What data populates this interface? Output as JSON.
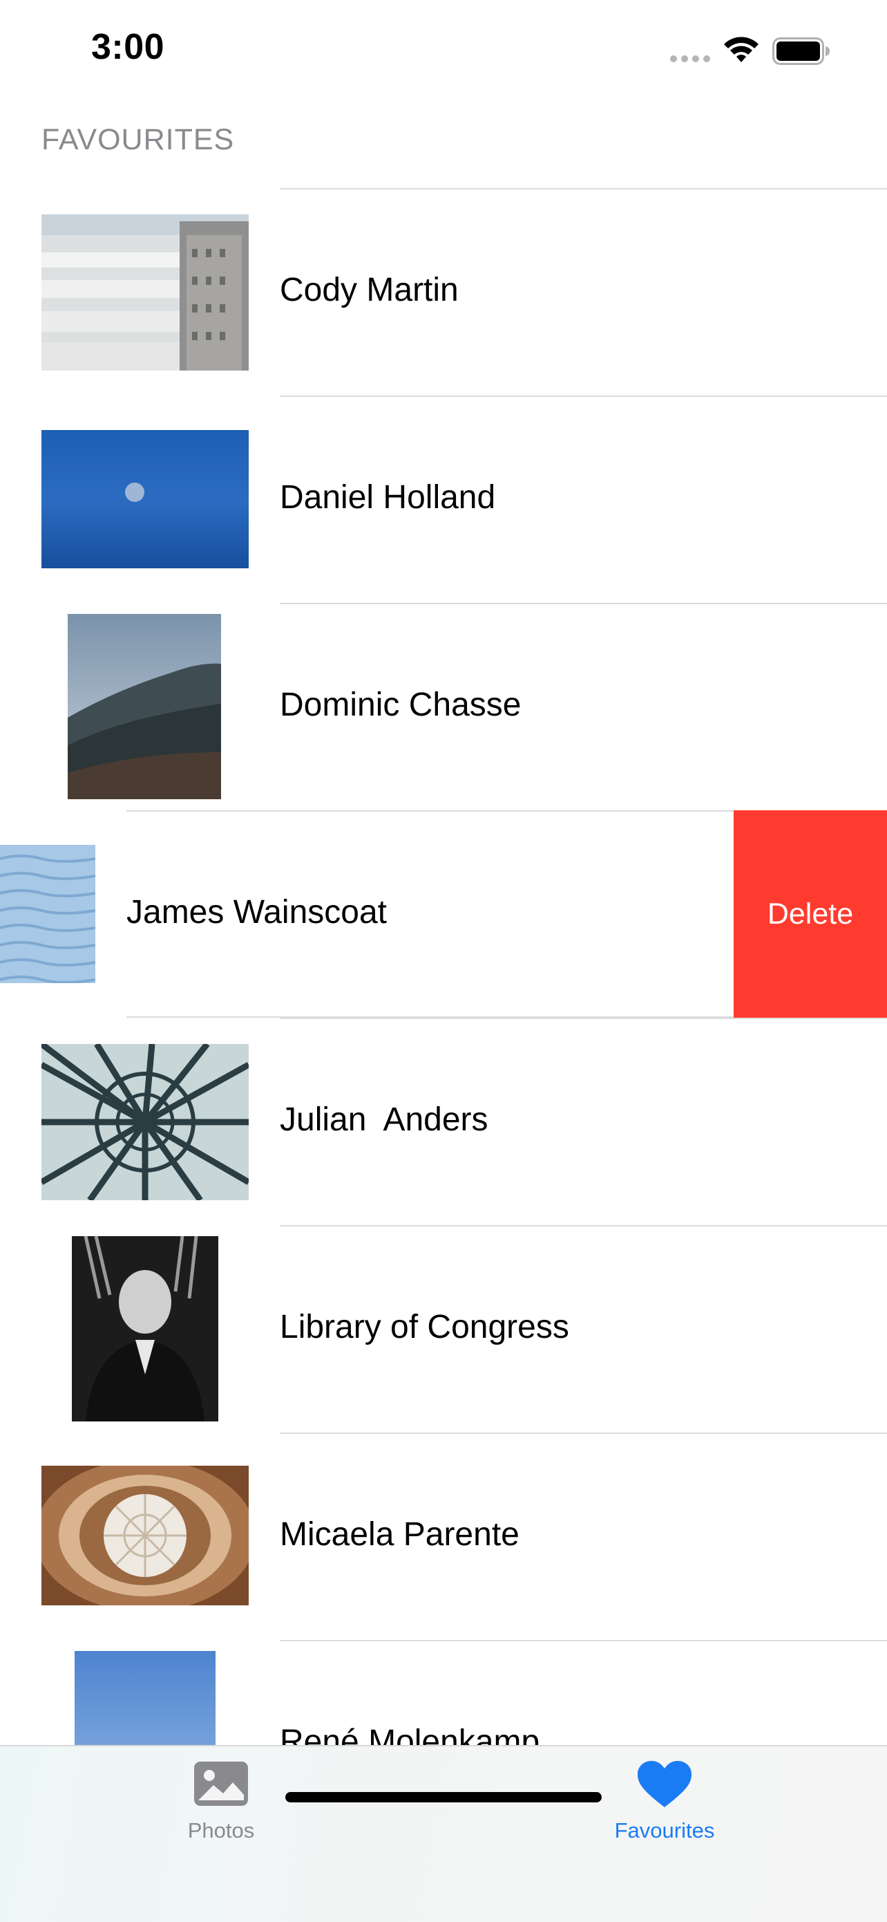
{
  "status_bar": {
    "time": "3:00"
  },
  "section": {
    "title": "FAVOURITES"
  },
  "rows": [
    {
      "name": "Cody Martin",
      "thumb": "guggenheim-exterior"
    },
    {
      "name": "Daniel Holland",
      "thumb": "blue-sky-moon"
    },
    {
      "name": "Dominic Chasse",
      "thumb": "forest-hillside"
    },
    {
      "name": "James Wainscoat",
      "thumb": "water-surface",
      "swiped": true,
      "action_label": "Delete"
    },
    {
      "name": "Julian  Anders",
      "thumb": "glass-dome"
    },
    {
      "name": "Library of Congress",
      "thumb": "portrait-bw"
    },
    {
      "name": "Micaela Parente",
      "thumb": "spiral-skylight"
    },
    {
      "name": "René Molenkamp",
      "thumb": "blue-gradient"
    }
  ],
  "tabs": [
    {
      "label": "Photos",
      "icon": "photo-icon",
      "selected": false
    },
    {
      "label": "Favourites",
      "icon": "heart-icon",
      "selected": true
    }
  ],
  "colors": {
    "accent": "#1a7cf5",
    "delete": "#ff3b30",
    "secondary_text": "#8a8a8e"
  }
}
